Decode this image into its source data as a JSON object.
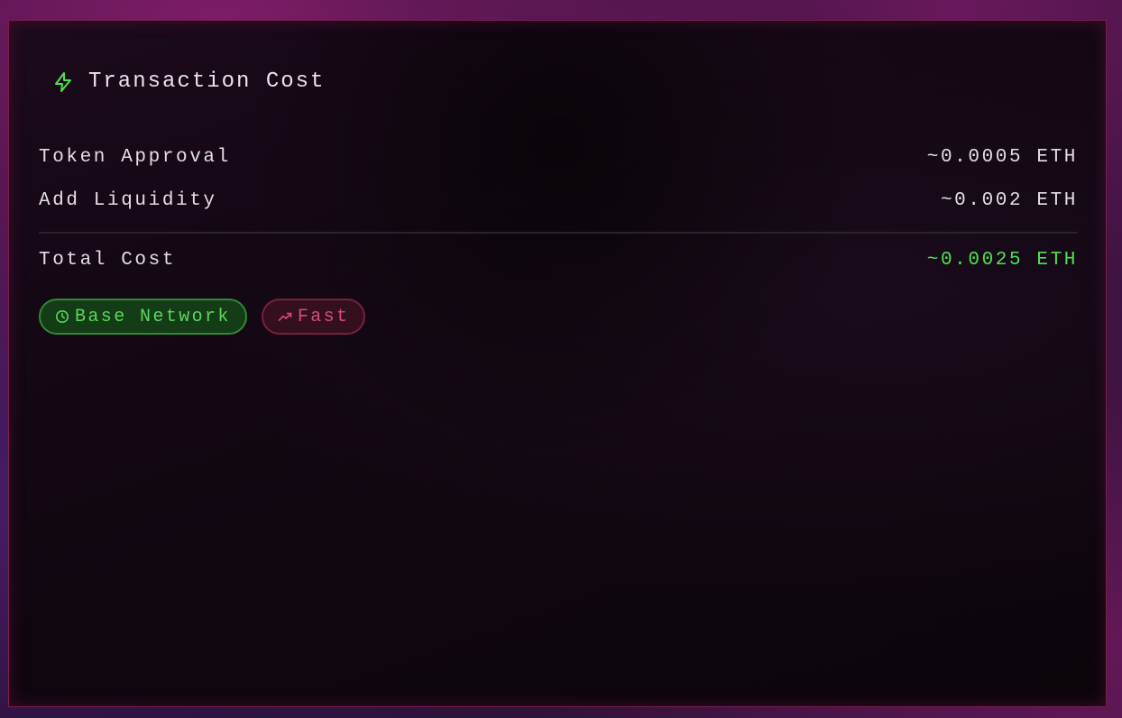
{
  "card": {
    "title": "Transaction Cost",
    "title_icon": "lightning-icon"
  },
  "costs": [
    {
      "label": "Token Approval",
      "value": "~0.0005 ETH"
    },
    {
      "label": "Add Liquidity",
      "value": "~0.002 ETH"
    }
  ],
  "total": {
    "label": "Total Cost",
    "value": "~0.0025 ETH"
  },
  "badges": [
    {
      "label": "Base Network",
      "icon": "clock-icon",
      "color": "#5bd65b"
    },
    {
      "label": "Fast",
      "icon": "trending-up-icon",
      "color": "#d64a7a"
    }
  ],
  "colors": {
    "accent_green": "#4ee24e",
    "accent_pink": "#d64a7a",
    "border": "#7a1e4c"
  }
}
